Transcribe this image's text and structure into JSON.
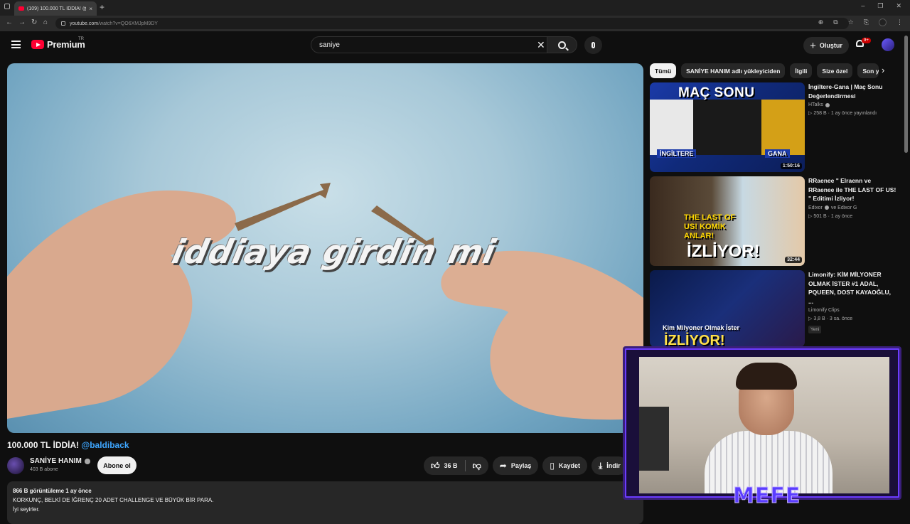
{
  "browser": {
    "tab_title": "(109) 100.000 TL İDDİA! @bal...",
    "tab_close": "×",
    "new_tab": "+",
    "window_controls": [
      "–",
      "❐",
      "✕"
    ],
    "url_host": "youtube.com",
    "url_path": "/watch?v=QO6XMJpM9DY",
    "nav": [
      "←",
      "→",
      "↻",
      "⌂"
    ],
    "right_icons": [
      "⊕",
      "⧉",
      "☆",
      "⎘"
    ]
  },
  "header": {
    "logo_word": "Premium",
    "country_code": "TR",
    "search_value": "saniye",
    "clear_glyph": "✕",
    "create_label": "Oluştur",
    "create_plus": "+",
    "notif_badge": "9+"
  },
  "video": {
    "overlay_text": "iddiaya girdin mi",
    "title": "100.000 TL İDDİA!",
    "title_tag": "@baldiback",
    "channel_name": "SANİYE HANIM",
    "subscribers": "403 B abone",
    "subscribe_label": "Abone ol",
    "likes": "36 B",
    "share_label": "Paylaş",
    "save_label": "Kaydet",
    "download_label": "İndir",
    "desc_meta": "866 B görüntüleme  1 ay önce",
    "desc_line1": "KORKUNÇ, BELKİ DE İĞRENÇ 20 ADET CHALLENGE VE BÜYÜK BİR PARA.",
    "desc_line2": "İyi seyirler."
  },
  "chips": [
    "Tümü",
    "SANİYE HANIM adlı yükleyiciden",
    "İlgili",
    "Size özel",
    "Son y..."
  ],
  "recommendations": [
    {
      "title": "İngiltere-Gana | Maç Sonu Değerlendirmesi",
      "channel": "HTalks",
      "meta": "▷ 258 B · 1 ay önce yayınlandı",
      "duration": "1:50:16",
      "thumb_text": "MAÇ SONU",
      "thumb_sub_left": "İNGİLTERE",
      "thumb_sub_right": "GANA"
    },
    {
      "title": "RRaenee \" Elraenn ve RRaenee ile THE LAST OF US! \" Editimi İzliyor!",
      "channel": "Edixor",
      "channel_extra": "ve Edixor G",
      "meta": "▷ 501 B · 1 ay önce",
      "duration": "32:44",
      "thumb_text": "İZLİYOR!",
      "thumb_sub": "THE LAST OF US! KOMİK ANLAR!"
    },
    {
      "title": "Limonify: KİM MİLYONER OLMAK İSTER #1 ADAL, PQUEEN, DOST KAYAOĞLU, ...",
      "channel": "Limonify Clips",
      "meta": "▷ 3,8 B · 3 sa. önce",
      "badge": "Yeni",
      "thumb_text": "İZLİYOR!",
      "thumb_sub": "Kim Milyoner Olmak İster"
    }
  ],
  "webcam": {
    "name": "MEFE"
  },
  "colors": {
    "bg": "#0f0f0f",
    "youtube_red": "#ff0033",
    "link_blue": "#3ea6ff",
    "webcam_accent": "#6b3cff"
  }
}
